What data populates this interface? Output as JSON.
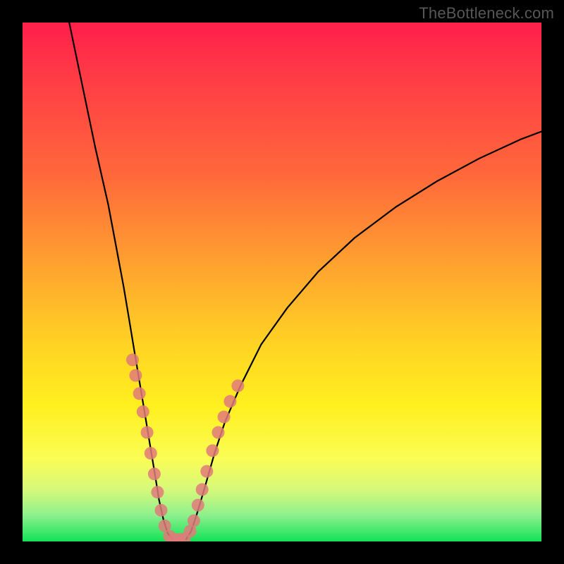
{
  "watermark": "TheBottleneck.com",
  "chart_data": {
    "type": "line",
    "title": "",
    "xlabel": "",
    "ylabel": "",
    "xlim": [
      0,
      100
    ],
    "ylim": [
      0,
      100
    ],
    "grid": false,
    "legend": false,
    "background_gradient": {
      "direction": "vertical",
      "stops": [
        {
          "pos": 0.0,
          "color": "#ff1f4b"
        },
        {
          "pos": 0.3,
          "color": "#ff6a3a"
        },
        {
          "pos": 0.62,
          "color": "#ffd323"
        },
        {
          "pos": 0.84,
          "color": "#fafd55"
        },
        {
          "pos": 1.0,
          "color": "#12e257"
        }
      ]
    },
    "series": [
      {
        "name": "left-curve",
        "type": "line",
        "stroke": "#000000",
        "points": [
          {
            "x": 9.0,
            "y": 100.0
          },
          {
            "x": 11.5,
            "y": 88.0
          },
          {
            "x": 14.0,
            "y": 76.0
          },
          {
            "x": 16.5,
            "y": 65.0
          },
          {
            "x": 18.0,
            "y": 57.0
          },
          {
            "x": 19.5,
            "y": 49.0
          },
          {
            "x": 20.5,
            "y": 43.0
          },
          {
            "x": 21.5,
            "y": 37.0
          },
          {
            "x": 22.5,
            "y": 31.0
          },
          {
            "x": 23.5,
            "y": 25.0
          },
          {
            "x": 24.5,
            "y": 19.0
          },
          {
            "x": 25.5,
            "y": 13.0
          },
          {
            "x": 26.3,
            "y": 8.0
          },
          {
            "x": 27.2,
            "y": 4.0
          },
          {
            "x": 28.0,
            "y": 1.5
          },
          {
            "x": 29.0,
            "y": 0.4
          }
        ]
      },
      {
        "name": "right-curve",
        "type": "line",
        "stroke": "#000000",
        "points": [
          {
            "x": 31.5,
            "y": 0.4
          },
          {
            "x": 32.5,
            "y": 2.0
          },
          {
            "x": 33.5,
            "y": 5.0
          },
          {
            "x": 35.0,
            "y": 10.0
          },
          {
            "x": 37.0,
            "y": 17.0
          },
          {
            "x": 39.0,
            "y": 23.0
          },
          {
            "x": 42.0,
            "y": 30.0
          },
          {
            "x": 46.0,
            "y": 38.0
          },
          {
            "x": 51.0,
            "y": 45.0
          },
          {
            "x": 57.0,
            "y": 52.0
          },
          {
            "x": 64.0,
            "y": 58.5
          },
          {
            "x": 72.0,
            "y": 64.5
          },
          {
            "x": 80.0,
            "y": 69.5
          },
          {
            "x": 88.0,
            "y": 73.8
          },
          {
            "x": 96.0,
            "y": 77.5
          },
          {
            "x": 100.0,
            "y": 79.0
          }
        ]
      },
      {
        "name": "dots-left",
        "type": "scatter",
        "color": "#e07a7a",
        "points": [
          {
            "x": 21.2,
            "y": 35.0
          },
          {
            "x": 21.8,
            "y": 32.0
          },
          {
            "x": 22.5,
            "y": 28.5
          },
          {
            "x": 23.2,
            "y": 25.0
          },
          {
            "x": 24.0,
            "y": 21.0
          },
          {
            "x": 24.7,
            "y": 17.0
          },
          {
            "x": 25.4,
            "y": 13.0
          },
          {
            "x": 26.0,
            "y": 9.5
          },
          {
            "x": 26.7,
            "y": 6.0
          },
          {
            "x": 27.4,
            "y": 3.0
          },
          {
            "x": 28.3,
            "y": 1.0
          },
          {
            "x": 29.2,
            "y": 0.4
          },
          {
            "x": 30.2,
            "y": 0.4
          },
          {
            "x": 31.2,
            "y": 0.5
          }
        ]
      },
      {
        "name": "dots-right",
        "type": "scatter",
        "color": "#e07a7a",
        "points": [
          {
            "x": 32.3,
            "y": 2.0
          },
          {
            "x": 33.0,
            "y": 4.0
          },
          {
            "x": 33.8,
            "y": 7.0
          },
          {
            "x": 34.6,
            "y": 10.0
          },
          {
            "x": 35.5,
            "y": 13.5
          },
          {
            "x": 36.6,
            "y": 17.5
          },
          {
            "x": 37.7,
            "y": 21.0
          },
          {
            "x": 38.8,
            "y": 24.0
          },
          {
            "x": 40.0,
            "y": 27.0
          },
          {
            "x": 41.5,
            "y": 30.0
          }
        ]
      }
    ]
  }
}
